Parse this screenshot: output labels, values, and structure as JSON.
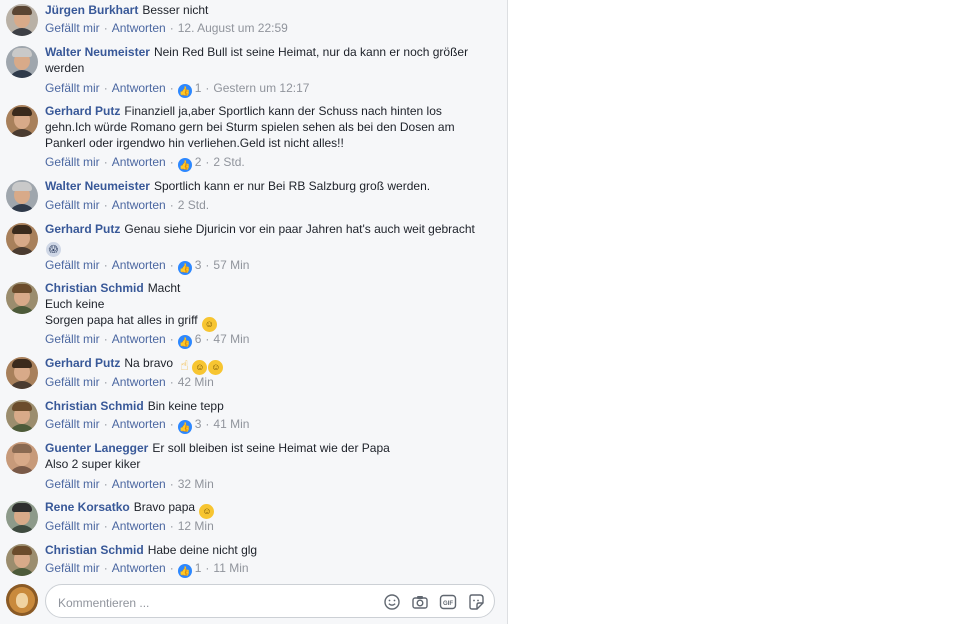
{
  "labels": {
    "like": "Gefällt mir",
    "reply": "Antworten"
  },
  "comments": [
    {
      "author": "Jürgen Burkhart",
      "text": "Besser nicht",
      "likes": null,
      "time": "12. August um 22:59"
    },
    {
      "author": "Walter Neumeister",
      "text": "Nein Red Bull ist seine Heimat, nur da kann er noch größer werden",
      "likes": "1",
      "time": "Gestern um 12:17"
    },
    {
      "author": "Gerhard Putz",
      "text": "Finanziell ja,aber Sportlich kann der Schuss nach hinten los gehn.Ich würde Romano gern bei Sturm spielen sehen als bei den Dosen am Pankerl oder irgendwo hin verliehen.Geld ist nicht alles!!",
      "likes": "2",
      "time": "2 Std."
    },
    {
      "author": "Walter Neumeister",
      "text": "Sportlich kann er nur Bei RB Salzburg groß werden.",
      "likes": null,
      "time": "2 Std."
    },
    {
      "author": "Gerhard Putz",
      "text": "Genau siehe Djuricin vor ein paar Jahren hat's auch weit gebracht",
      "likes": "3",
      "time": "57 Min"
    },
    {
      "author": "Christian Schmid",
      "text": "Macht\nEuch keine\nSorgen papa hat alles in griff",
      "likes": "6",
      "time": "47 Min"
    },
    {
      "author": "Gerhard Putz",
      "text": "Na bravo",
      "likes": null,
      "time": "42 Min"
    },
    {
      "author": "Christian Schmid",
      "text": "Bin keine tepp",
      "likes": "3",
      "time": "41 Min"
    },
    {
      "author": "Guenter Lanegger",
      "text": "Er soll bleiben ist seine Heimat wie der Papa\nAlso 2 super kiker",
      "likes": null,
      "time": "32 Min"
    },
    {
      "author": "Rene Korsatko",
      "text": "Bravo papa",
      "likes": null,
      "time": "12 Min"
    },
    {
      "author": "Christian Schmid",
      "text": "Habe deine nicht glg",
      "likes": "1",
      "time": "11 Min"
    }
  ],
  "composer": {
    "placeholder": "Kommentieren ..."
  },
  "icons": [
    "thumbs-up-icon",
    "emoji-smile-icon",
    "camera-icon",
    "gif-icon",
    "sticker-icon"
  ],
  "colors": {
    "author": "#385898",
    "link": "#4b67a1",
    "meta": "#90949c",
    "like_badge": "#2d88ff",
    "panel_bg": "#f6f7f9"
  }
}
